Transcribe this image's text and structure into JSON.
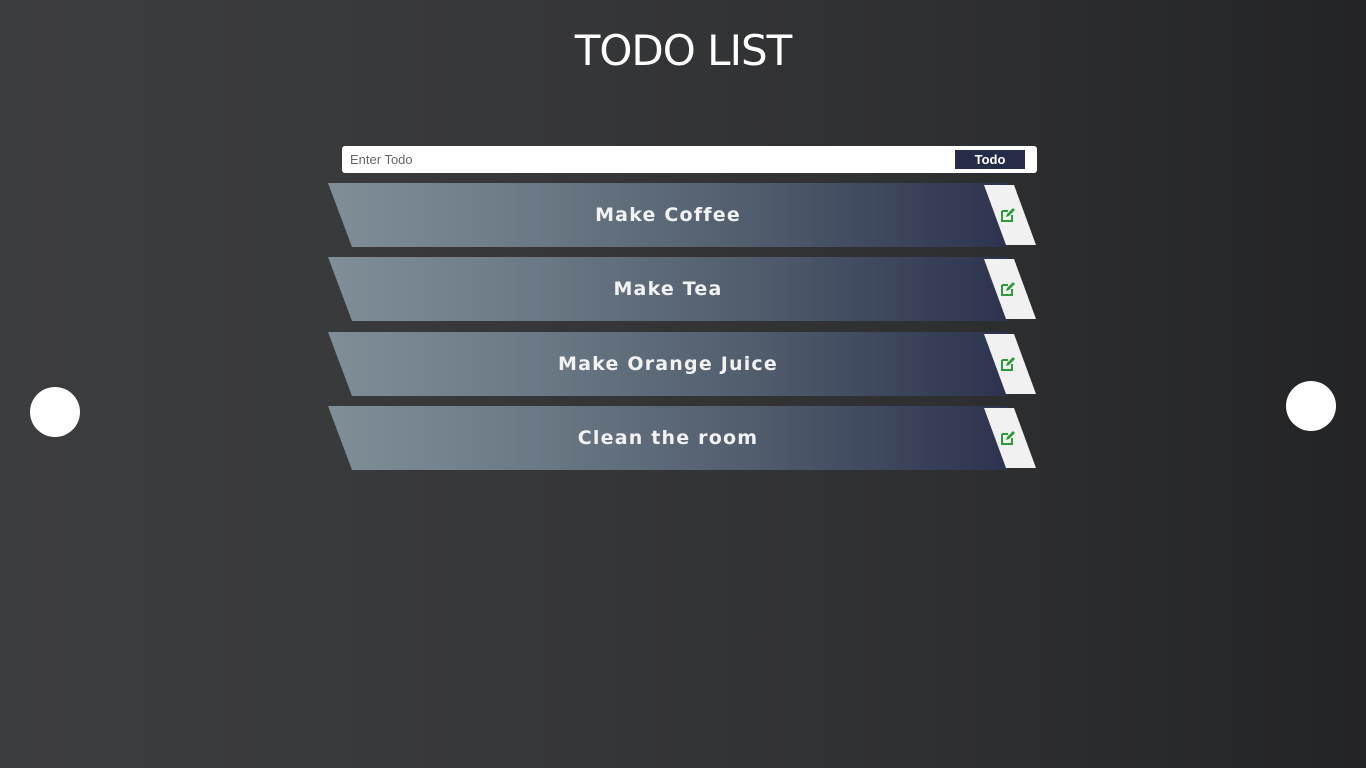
{
  "header": {
    "title": "TODO LIST"
  },
  "input": {
    "placeholder": "Enter Todo",
    "value": "",
    "button_label": "Todo"
  },
  "todos": [
    {
      "label": "Make Coffee",
      "icon": "edit-icon"
    },
    {
      "label": "Make Tea",
      "icon": "edit-icon"
    },
    {
      "label": "Make Orange Juice",
      "icon": "edit-icon"
    },
    {
      "label": "Clean the room",
      "icon": "edit-icon"
    }
  ],
  "colors": {
    "accent": "#262b47",
    "icon": "#2e9b3a",
    "bar_start": "#7f8e97",
    "bar_end": "#2c334f"
  }
}
